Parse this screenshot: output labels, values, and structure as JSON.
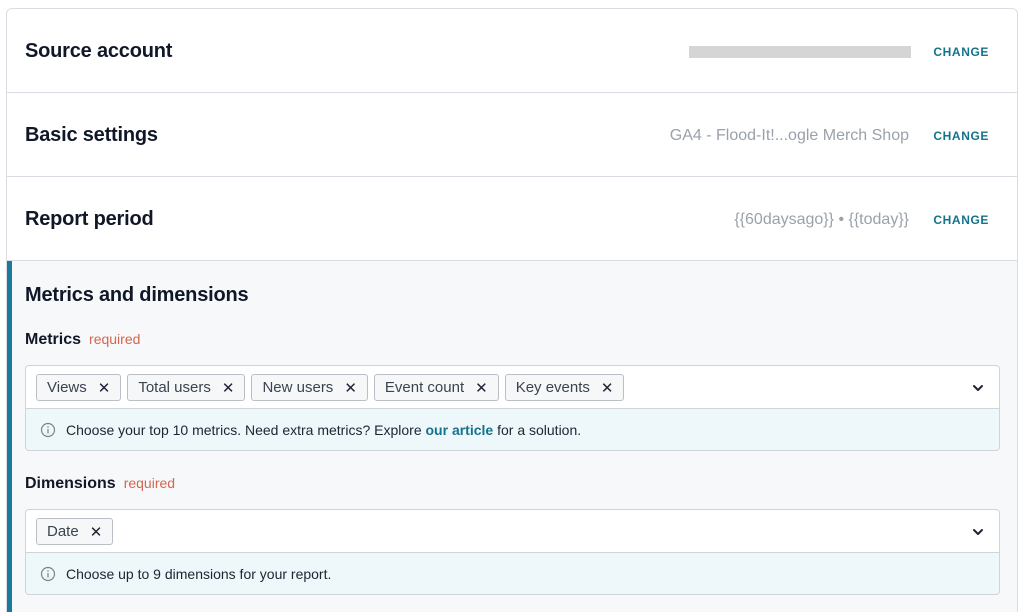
{
  "sections": {
    "source_account": {
      "title": "Source account",
      "value": "",
      "change_label": "CHANGE"
    },
    "basic_settings": {
      "title": "Basic settings",
      "value": "GA4 - Flood-It!...ogle Merch Shop",
      "change_label": "CHANGE"
    },
    "report_period": {
      "title": "Report period",
      "value": "{{60daysago}} • {{today}}",
      "change_label": "CHANGE"
    }
  },
  "metrics_dimensions": {
    "title": "Metrics and dimensions",
    "metrics": {
      "label": "Metrics",
      "required": "required",
      "selected": [
        "Views",
        "Total users",
        "New users",
        "Event count",
        "Key events"
      ],
      "hint_before": "Choose your top 10 metrics. Need extra metrics? Explore ",
      "hint_link": "our article",
      "hint_after": " for a solution."
    },
    "dimensions": {
      "label": "Dimensions",
      "required": "required",
      "selected": [
        "Date"
      ],
      "hint": "Choose up to 9 dimensions for your report."
    }
  },
  "icons": {
    "chip_remove": "close-icon",
    "dropdown": "chevron-down-icon",
    "info": "info-icon"
  },
  "colors": {
    "accent": "#15728d",
    "active_bar": "#1b7a9c",
    "required": "#d3664f",
    "hint_bg": "#eef7fa",
    "muted_text": "#9aa1ab"
  }
}
